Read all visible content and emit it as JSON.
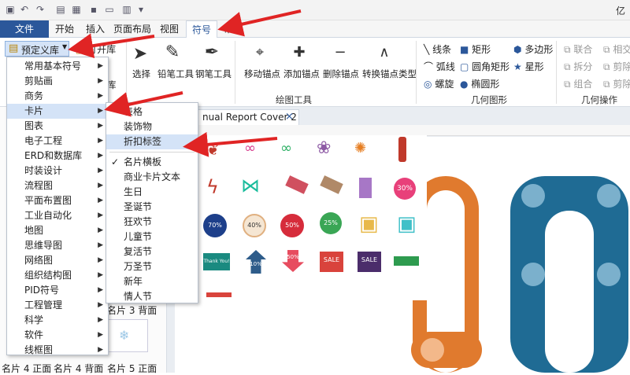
{
  "title_bar": {
    "app_label": "亿"
  },
  "menu_tabs": [
    {
      "label": "文件"
    },
    {
      "label": "开始"
    },
    {
      "label": "插入"
    },
    {
      "label": "页面布局"
    },
    {
      "label": "视图"
    },
    {
      "label": "符号"
    },
    {
      "label": "帮助"
    }
  ],
  "ribbon": {
    "preset_library": "预定义库",
    "open_library": "打开库",
    "cut_library": "库",
    "select": "选择",
    "pencil_tool": "铅笔工具",
    "pen_tool": "钢笔工具",
    "move_anchor": "移动锚点",
    "add_anchor": "添加锚点",
    "delete_anchor": "删除锚点",
    "convert_anchor": "转换锚点类型",
    "drawing_tools_group": "绘图工具",
    "shapes": {
      "line": "线条",
      "arc": "弧线",
      "spiral": "螺旋",
      "rect": "矩形",
      "round_rect": "圆角矩形",
      "ellipse": "椭圆形",
      "polygon": "多边形",
      "star": "星形"
    },
    "geometry_group": "几何图形",
    "ops": {
      "union": "联合",
      "split": "拆分",
      "combine": "组合",
      "intersect": "相交",
      "cut": "剪除",
      "cut2": "剪除"
    },
    "geometry_ops_group": "几何操作"
  },
  "document_tab": {
    "title": "nual Report Cover 2",
    "close": "×"
  },
  "library_panel": {
    "thumb_label_1": "名片 3 背面",
    "bottom_labels": [
      "名片 4 正面",
      "名片 4 背面",
      "名片 5 正面"
    ]
  },
  "menu_level1": [
    {
      "label": "常用基本符号",
      "submenu": true
    },
    {
      "label": "剪贴画",
      "submenu": true
    },
    {
      "label": "商务",
      "submenu": true
    },
    {
      "label": "卡片",
      "submenu": true
    },
    {
      "label": "图表",
      "submenu": true
    },
    {
      "label": "电子工程",
      "submenu": true
    },
    {
      "label": "ERD和数据库",
      "submenu": true
    },
    {
      "label": "时装设计",
      "submenu": true
    },
    {
      "label": "流程图",
      "submenu": true
    },
    {
      "label": "平面布置图",
      "submenu": true
    },
    {
      "label": "工业自动化",
      "submenu": true
    },
    {
      "label": "地图",
      "submenu": true
    },
    {
      "label": "思维导图",
      "submenu": true
    },
    {
      "label": "网络图",
      "submenu": true
    },
    {
      "label": "组织结构图",
      "submenu": true
    },
    {
      "label": "PID符号",
      "submenu": true
    },
    {
      "label": "工程管理",
      "submenu": true
    },
    {
      "label": "科学",
      "submenu": true
    },
    {
      "label": "软件",
      "submenu": true
    },
    {
      "label": "线框图",
      "submenu": true
    }
  ],
  "menu_level2": [
    {
      "label": "表格",
      "checked": false
    },
    {
      "label": "装饰物",
      "checked": false
    },
    {
      "label": "折扣标签",
      "checked": false
    },
    {
      "label": "",
      "separator": true
    },
    {
      "label": "名片横板",
      "checked": true
    },
    {
      "label": "商业卡片文本",
      "checked": false
    },
    {
      "label": "生日",
      "checked": false
    },
    {
      "label": "圣诞节",
      "checked": false
    },
    {
      "label": "狂欢节",
      "checked": false
    },
    {
      "label": "儿童节",
      "checked": false
    },
    {
      "label": "复活节",
      "checked": false
    },
    {
      "label": "万圣节",
      "checked": false
    },
    {
      "label": "新年",
      "checked": false
    },
    {
      "label": "情人节",
      "checked": false
    }
  ],
  "sticker_labels": {
    "pct30": "30%",
    "pct70": "70%",
    "pct40": "40%",
    "pct50": "50%",
    "pct25": "25%",
    "sale1": "SALE",
    "sale2": "SALE",
    "thank": "Thank You!",
    "ten": "10%",
    "fifty": "50%"
  },
  "colors": {
    "file_tab": "#2b579a",
    "highlight": "#d4e3f7",
    "arrow": "#e02424",
    "orange": "#e07a2e",
    "blue": "#1f6b94"
  },
  "icons": [
    "undo-icon",
    "redo-icon",
    "save-icon",
    "print-icon",
    "select-arrow-icon",
    "pencil-icon",
    "pen-icon",
    "anchor-icon",
    "checkmark-icon",
    "close-icon"
  ]
}
